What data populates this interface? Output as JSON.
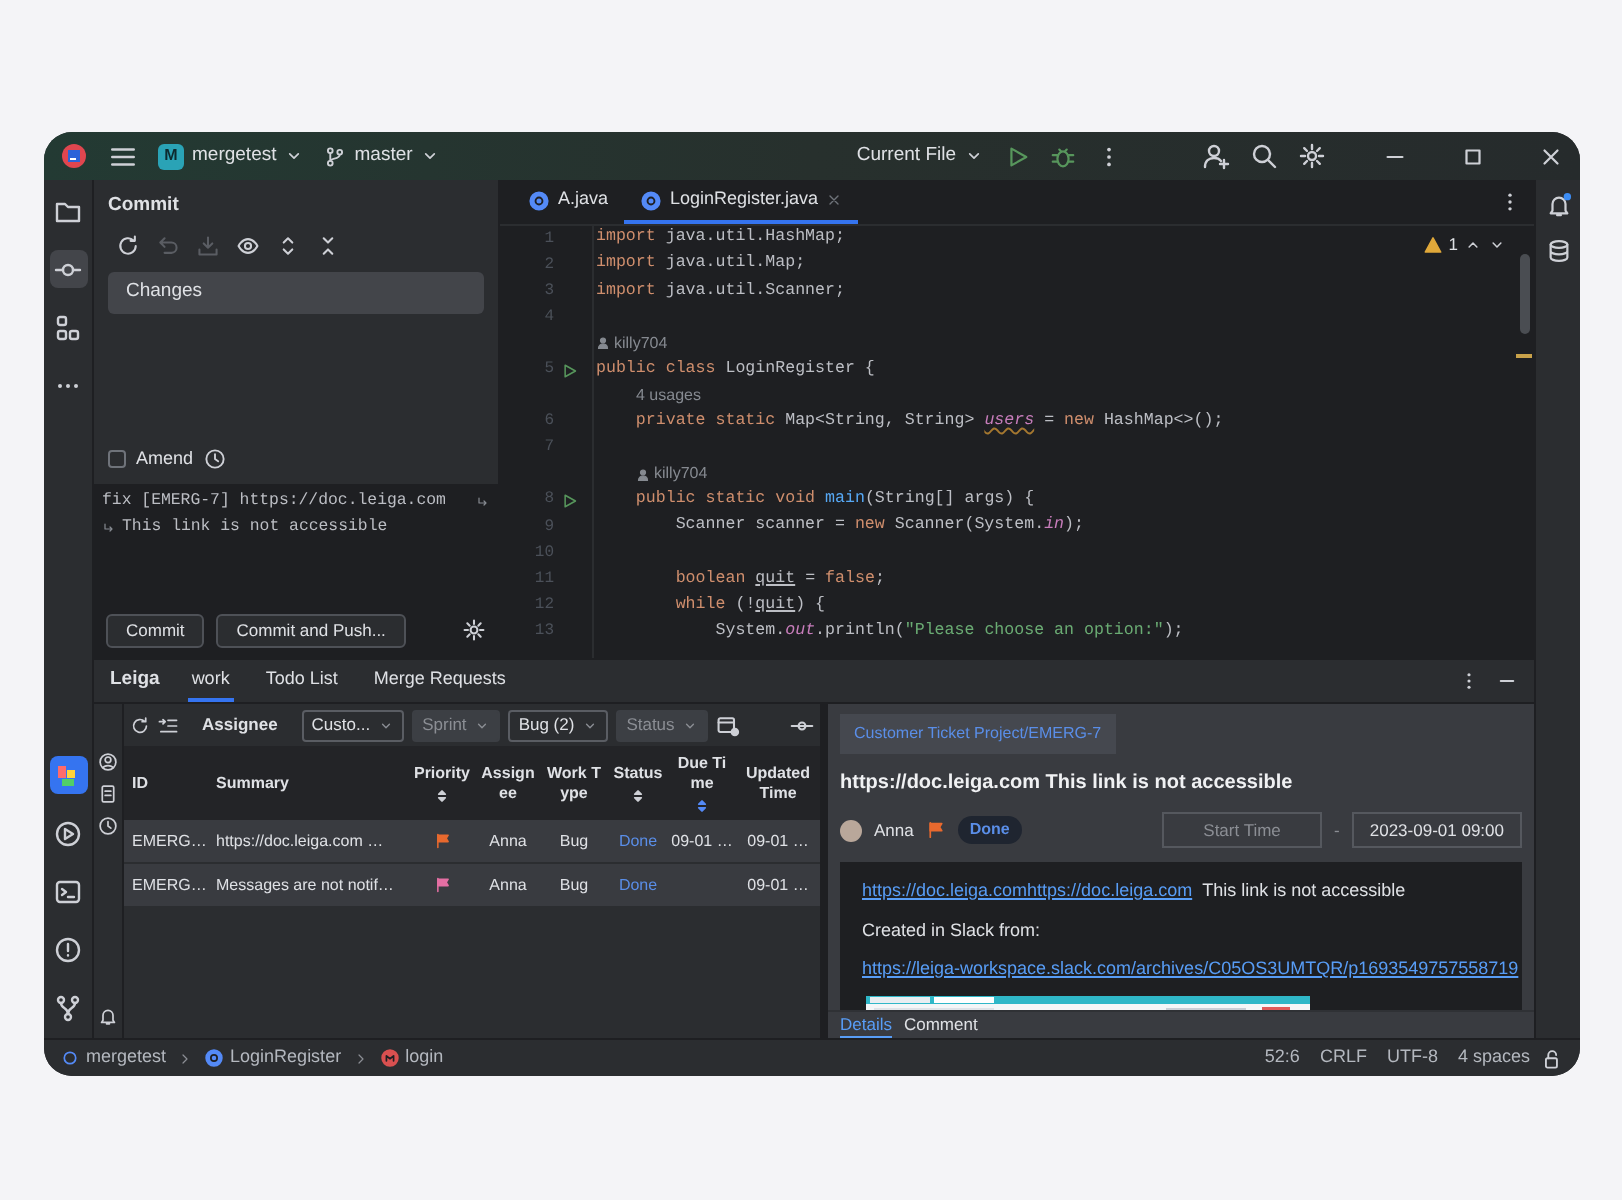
{
  "title_bar": {
    "project_badge": "M",
    "project": "mergetest",
    "branch": "master",
    "run_config": "Current File"
  },
  "left_toolbar": {
    "top": [
      {
        "kind": "project",
        "selected": false
      },
      {
        "kind": "commit",
        "selected": true
      },
      {
        "kind": "structure",
        "selected": false
      },
      {
        "kind": "more",
        "selected": false
      }
    ],
    "bottom": [
      {
        "kind": "leiga",
        "selected": true
      },
      {
        "kind": "run",
        "selected": false
      },
      {
        "kind": "terminal",
        "selected": false
      },
      {
        "kind": "problems",
        "selected": false
      },
      {
        "kind": "git",
        "selected": false
      }
    ]
  },
  "commit": {
    "title": "Commit",
    "toolbar": [
      {
        "kind": "refresh",
        "disabled": false
      },
      {
        "kind": "undo",
        "disabled": true
      },
      {
        "kind": "download",
        "disabled": true
      },
      {
        "kind": "eye",
        "disabled": false
      },
      {
        "kind": "expand",
        "disabled": false
      },
      {
        "kind": "collapse",
        "disabled": false
      }
    ],
    "changes_group": "Changes",
    "amend": {
      "label": "Amend",
      "checked": false
    },
    "message": [
      "fix [EMERG-7] https://doc.leiga.com",
      "This link is not accessible"
    ],
    "buttons": [
      "Commit",
      "Commit and Push..."
    ]
  },
  "editor": {
    "tabs": [
      {
        "label": "A.java",
        "selected": false
      },
      {
        "label": "LoginRegister.java",
        "selected": true
      }
    ],
    "warnings": "1",
    "lines": [
      {
        "number": "1",
        "tokens": [
          {
            "kind": "kw",
            "text": "import"
          },
          {
            "kind": "plain",
            "text": " java.util.HashMap;"
          }
        ]
      },
      {
        "number": "2",
        "tokens": [
          {
            "kind": "kw",
            "text": "import"
          },
          {
            "kind": "plain",
            "text": " java.util.Map;"
          }
        ]
      },
      {
        "number": "3",
        "tokens": [
          {
            "kind": "kw",
            "text": "import"
          },
          {
            "kind": "plain",
            "text": " java.util.Scanner;"
          }
        ]
      },
      {
        "number": "4"
      },
      {
        "hint": "killy704",
        "kind": "author"
      },
      {
        "number": "5",
        "run": true,
        "tokens": [
          {
            "kind": "kw",
            "text": "public class"
          },
          {
            "kind": "plain",
            "text": " LoginRegister {"
          }
        ]
      },
      {
        "hint": "4 usages",
        "kind": "usages"
      },
      {
        "number": "6",
        "tokens": [
          {
            "kind": "kw",
            "text": "    private static"
          },
          {
            "kind": "plain",
            "text": " Map<String, String> "
          },
          {
            "kind": "unused",
            "text": "users"
          },
          {
            "kind": "plain",
            "text": " = "
          },
          {
            "kind": "kw",
            "text": "new"
          },
          {
            "kind": "plain",
            "text": " HashMap<>();"
          }
        ]
      },
      {
        "number": "7"
      },
      {
        "hint": "killy704",
        "kind": "author"
      },
      {
        "number": "8",
        "run": true,
        "tokens": [
          {
            "kind": "kw",
            "text": "    public static void "
          },
          {
            "kind": "method",
            "text": "main"
          },
          {
            "kind": "plain",
            "text": "(String[] args) {"
          }
        ]
      },
      {
        "number": "9",
        "tokens": [
          {
            "kind": "plain",
            "text": "        Scanner scanner = "
          },
          {
            "kind": "kw",
            "text": "new"
          },
          {
            "kind": "plain",
            "text": " Scanner(System."
          },
          {
            "kind": "field",
            "text": "in"
          },
          {
            "kind": "plain",
            "text": ");"
          }
        ]
      },
      {
        "number": "10"
      },
      {
        "number": "11",
        "tokens": [
          {
            "kind": "kw",
            "text": "        boolean "
          },
          {
            "kind": "var",
            "text": "quit"
          },
          {
            "kind": "plain",
            "text": " = "
          },
          {
            "kind": "kw",
            "text": "false"
          },
          {
            "kind": "plain",
            "text": ";"
          }
        ]
      },
      {
        "number": "12",
        "tokens": [
          {
            "kind": "kw",
            "text": "        while"
          },
          {
            "kind": "plain",
            "text": " (!"
          },
          {
            "kind": "var",
            "text": "quit"
          },
          {
            "kind": "plain",
            "text": ") {"
          }
        ]
      },
      {
        "number": "13",
        "tokens": [
          {
            "kind": "plain",
            "text": "            System."
          },
          {
            "kind": "field",
            "text": "out"
          },
          {
            "kind": "plain",
            "text": ".println("
          },
          {
            "kind": "str",
            "text": "\"Please choose an option:\""
          },
          {
            "kind": "plain",
            "text": ");"
          }
        ]
      }
    ]
  },
  "tool_window": {
    "title": "Leiga",
    "tabs": [
      {
        "label": "work",
        "selected": true
      },
      {
        "label": "Todo List",
        "selected": false
      },
      {
        "label": "Merge Requests",
        "selected": false
      }
    ],
    "filter_label": "Assignee",
    "filters": [
      {
        "label": "Custo...",
        "set": true
      },
      {
        "label": "Sprint",
        "set": false
      },
      {
        "label": "Bug (2)",
        "set": true
      },
      {
        "label": "Status",
        "set": false
      }
    ],
    "table": {
      "columns": [
        {
          "label": "ID"
        },
        {
          "label": "Summary"
        },
        {
          "label": "Priority",
          "sorted": false
        },
        {
          "label": "Assignee"
        },
        {
          "label": "Work Type"
        },
        {
          "label": "Status",
          "sorted": false
        },
        {
          "label": "Due Time",
          "sorted": true
        },
        {
          "label": "Updated Time"
        }
      ],
      "rows": [
        {
          "id": "EMERG…",
          "summary": "https://doc.leiga.com …",
          "color": "#e8692e",
          "assignee": "Anna",
          "work_type": "Bug",
          "status": "Done",
          "due": "09-01 …",
          "updated": "09-01 …"
        },
        {
          "id": "EMERG…",
          "summary": "Messages are not notif…",
          "color": "#e46fa3",
          "assignee": "Anna",
          "work_type": "Bug",
          "status": "Done",
          "updated": "09-01 …"
        }
      ]
    },
    "detail": {
      "breadcrumb": "Customer Ticket Project/EMERG-7",
      "title": "https://doc.leiga.com This link is not accessible",
      "assignee": "Anna",
      "color": "#e8692e",
      "status": "Done",
      "start_placeholder": "Start Time",
      "separator": "-",
      "end": "2023-09-01 09:00",
      "description": [
        [
          {
            "kind": "link",
            "text": "https://doc.leiga.comhttps://doc.leiga.com"
          },
          {
            "kind": "text",
            "text": "This link is not accessible"
          }
        ],
        [
          {
            "kind": "text",
            "text": "Created in Slack from:"
          }
        ],
        [
          {
            "kind": "link",
            "text": "https://leiga-workspace.slack.com/archives/C05OS3UMTQR/p1693549757558719"
          }
        ]
      ],
      "attachment": {
        "kind": "picture"
      },
      "tabs": [
        {
          "label": "Details",
          "selected": true
        },
        {
          "label": "Comment",
          "selected": false
        }
      ]
    }
  },
  "status_bar": {
    "breadcrumbs": [
      {
        "kind": "module",
        "label": "mergetest"
      },
      {
        "kind": "class",
        "label": "LoginRegister"
      },
      {
        "kind": "method",
        "label": "login"
      }
    ],
    "position": "52:6",
    "line_separator": "CRLF",
    "encoding": "UTF-8",
    "indent": "4 spaces"
  }
}
